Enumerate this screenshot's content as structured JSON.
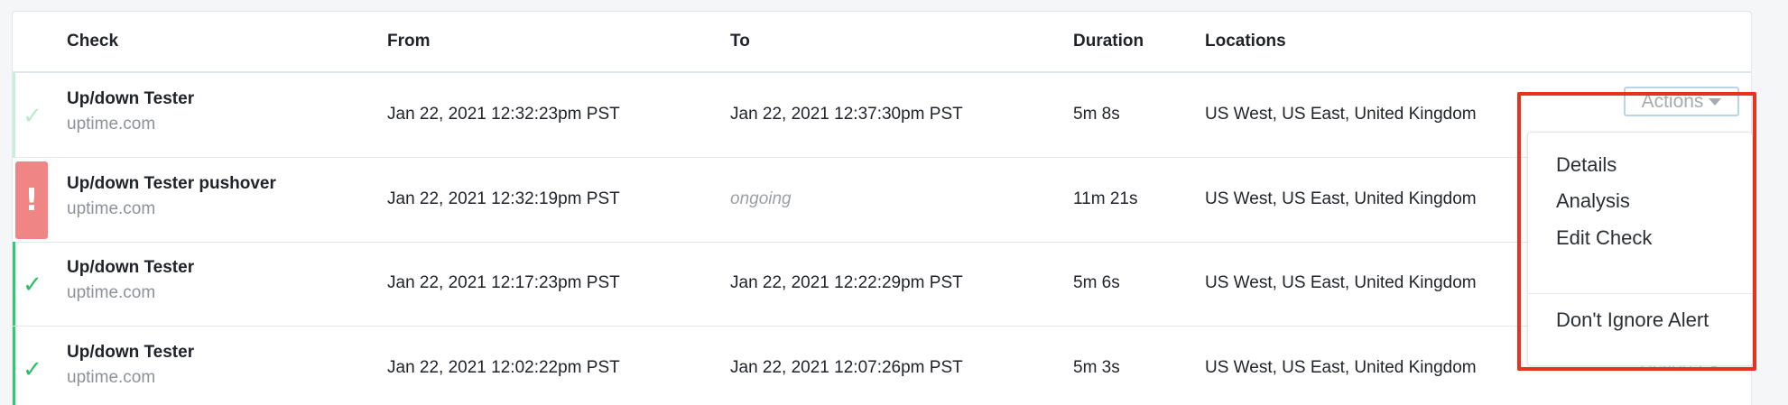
{
  "table": {
    "headers": {
      "check": "Check",
      "from": "From",
      "to": "To",
      "duration": "Duration",
      "locations": "Locations"
    },
    "rows": [
      {
        "status": "ok-light",
        "status_icon": "check-icon",
        "name": "Up/down Tester",
        "host": "uptime.com",
        "from": "Jan 22, 2021 12:32:23pm PST",
        "to": "Jan 22, 2021 12:37:30pm PST",
        "duration": "5m 8s",
        "locations": "US West, US East, United Kingdom"
      },
      {
        "status": "alert",
        "status_icon": "exclamation-icon",
        "name": "Up/down Tester pushover",
        "host": "uptime.com",
        "from": "Jan 22, 2021 12:32:19pm PST",
        "to": "ongoing",
        "duration": "11m 21s",
        "locations": "US West, US East, United Kingdom"
      },
      {
        "status": "ok",
        "status_icon": "check-icon",
        "name": "Up/down Tester",
        "host": "uptime.com",
        "from": "Jan 22, 2021 12:17:23pm PST",
        "to": "Jan 22, 2021 12:22:29pm PST",
        "duration": "5m 6s",
        "locations": "US West, US East, United Kingdom"
      },
      {
        "status": "ok",
        "status_icon": "check-icon",
        "name": "Up/down Tester",
        "host": "uptime.com",
        "from": "Jan 22, 2021 12:02:22pm PST",
        "to": "Jan 22, 2021 12:07:26pm PST",
        "duration": "5m 3s",
        "locations": "US West, US East, United Kingdom"
      }
    ]
  },
  "actions": {
    "label": "Actions",
    "menu": {
      "details": "Details",
      "analysis": "Analysis",
      "edit_check": "Edit Check",
      "dont_ignore_alert": "Don't Ignore Alert"
    }
  },
  "colors": {
    "ok": "#27c063",
    "alert": "#f08585",
    "highlight": "#e8311f",
    "focus_border": "#b7d3ef"
  }
}
